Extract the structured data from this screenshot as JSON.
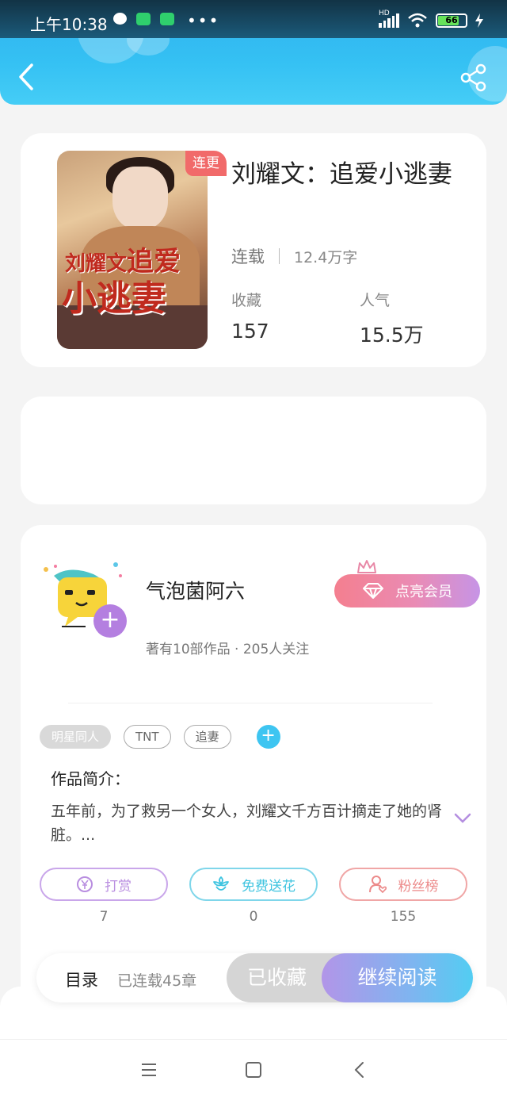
{
  "status_bar": {
    "time": "上午10:38",
    "battery": "66",
    "network": "HD"
  },
  "book": {
    "title": "刘耀文：追爱小逃妻",
    "cover_title_top": "刘耀文",
    "cover_title_main": "小逃妻",
    "cover_title_accent": "追爱",
    "update_tag": "连更",
    "status": "连载",
    "words": "12.4万字",
    "collect_label": "收藏",
    "collect_value": "157",
    "popularity_label": "人气",
    "popularity_value": "15.5万"
  },
  "author": {
    "name": "气泡菌阿六",
    "subtitle": "著有10部作品 · 205人关注",
    "vip_button": "点亮会员",
    "avatar_plus": "+"
  },
  "tags": [
    "明星同人",
    "TNT",
    "追妻"
  ],
  "intro": {
    "title": "作品简介：",
    "text": "五年前，为了救另一个女人，刘耀文千方百计摘走了她的肾脏。..."
  },
  "actions": [
    {
      "label": "打赏",
      "count": "7",
      "color": "#b98ee0"
    },
    {
      "label": "免费送花",
      "count": "0",
      "color": "#3fc4e0"
    },
    {
      "label": "粉丝榜",
      "count": "155",
      "color": "#ec8a8a"
    }
  ],
  "bottom_bar": {
    "toc": "目录",
    "chapters": "已连载45章",
    "collected": "已收藏",
    "continue": "继续阅读"
  },
  "colors": {
    "header": "#35c1f3",
    "accent_blue": "#3ec5f1",
    "tag_red": "#f16a6a",
    "purple": "#b47fe0"
  }
}
